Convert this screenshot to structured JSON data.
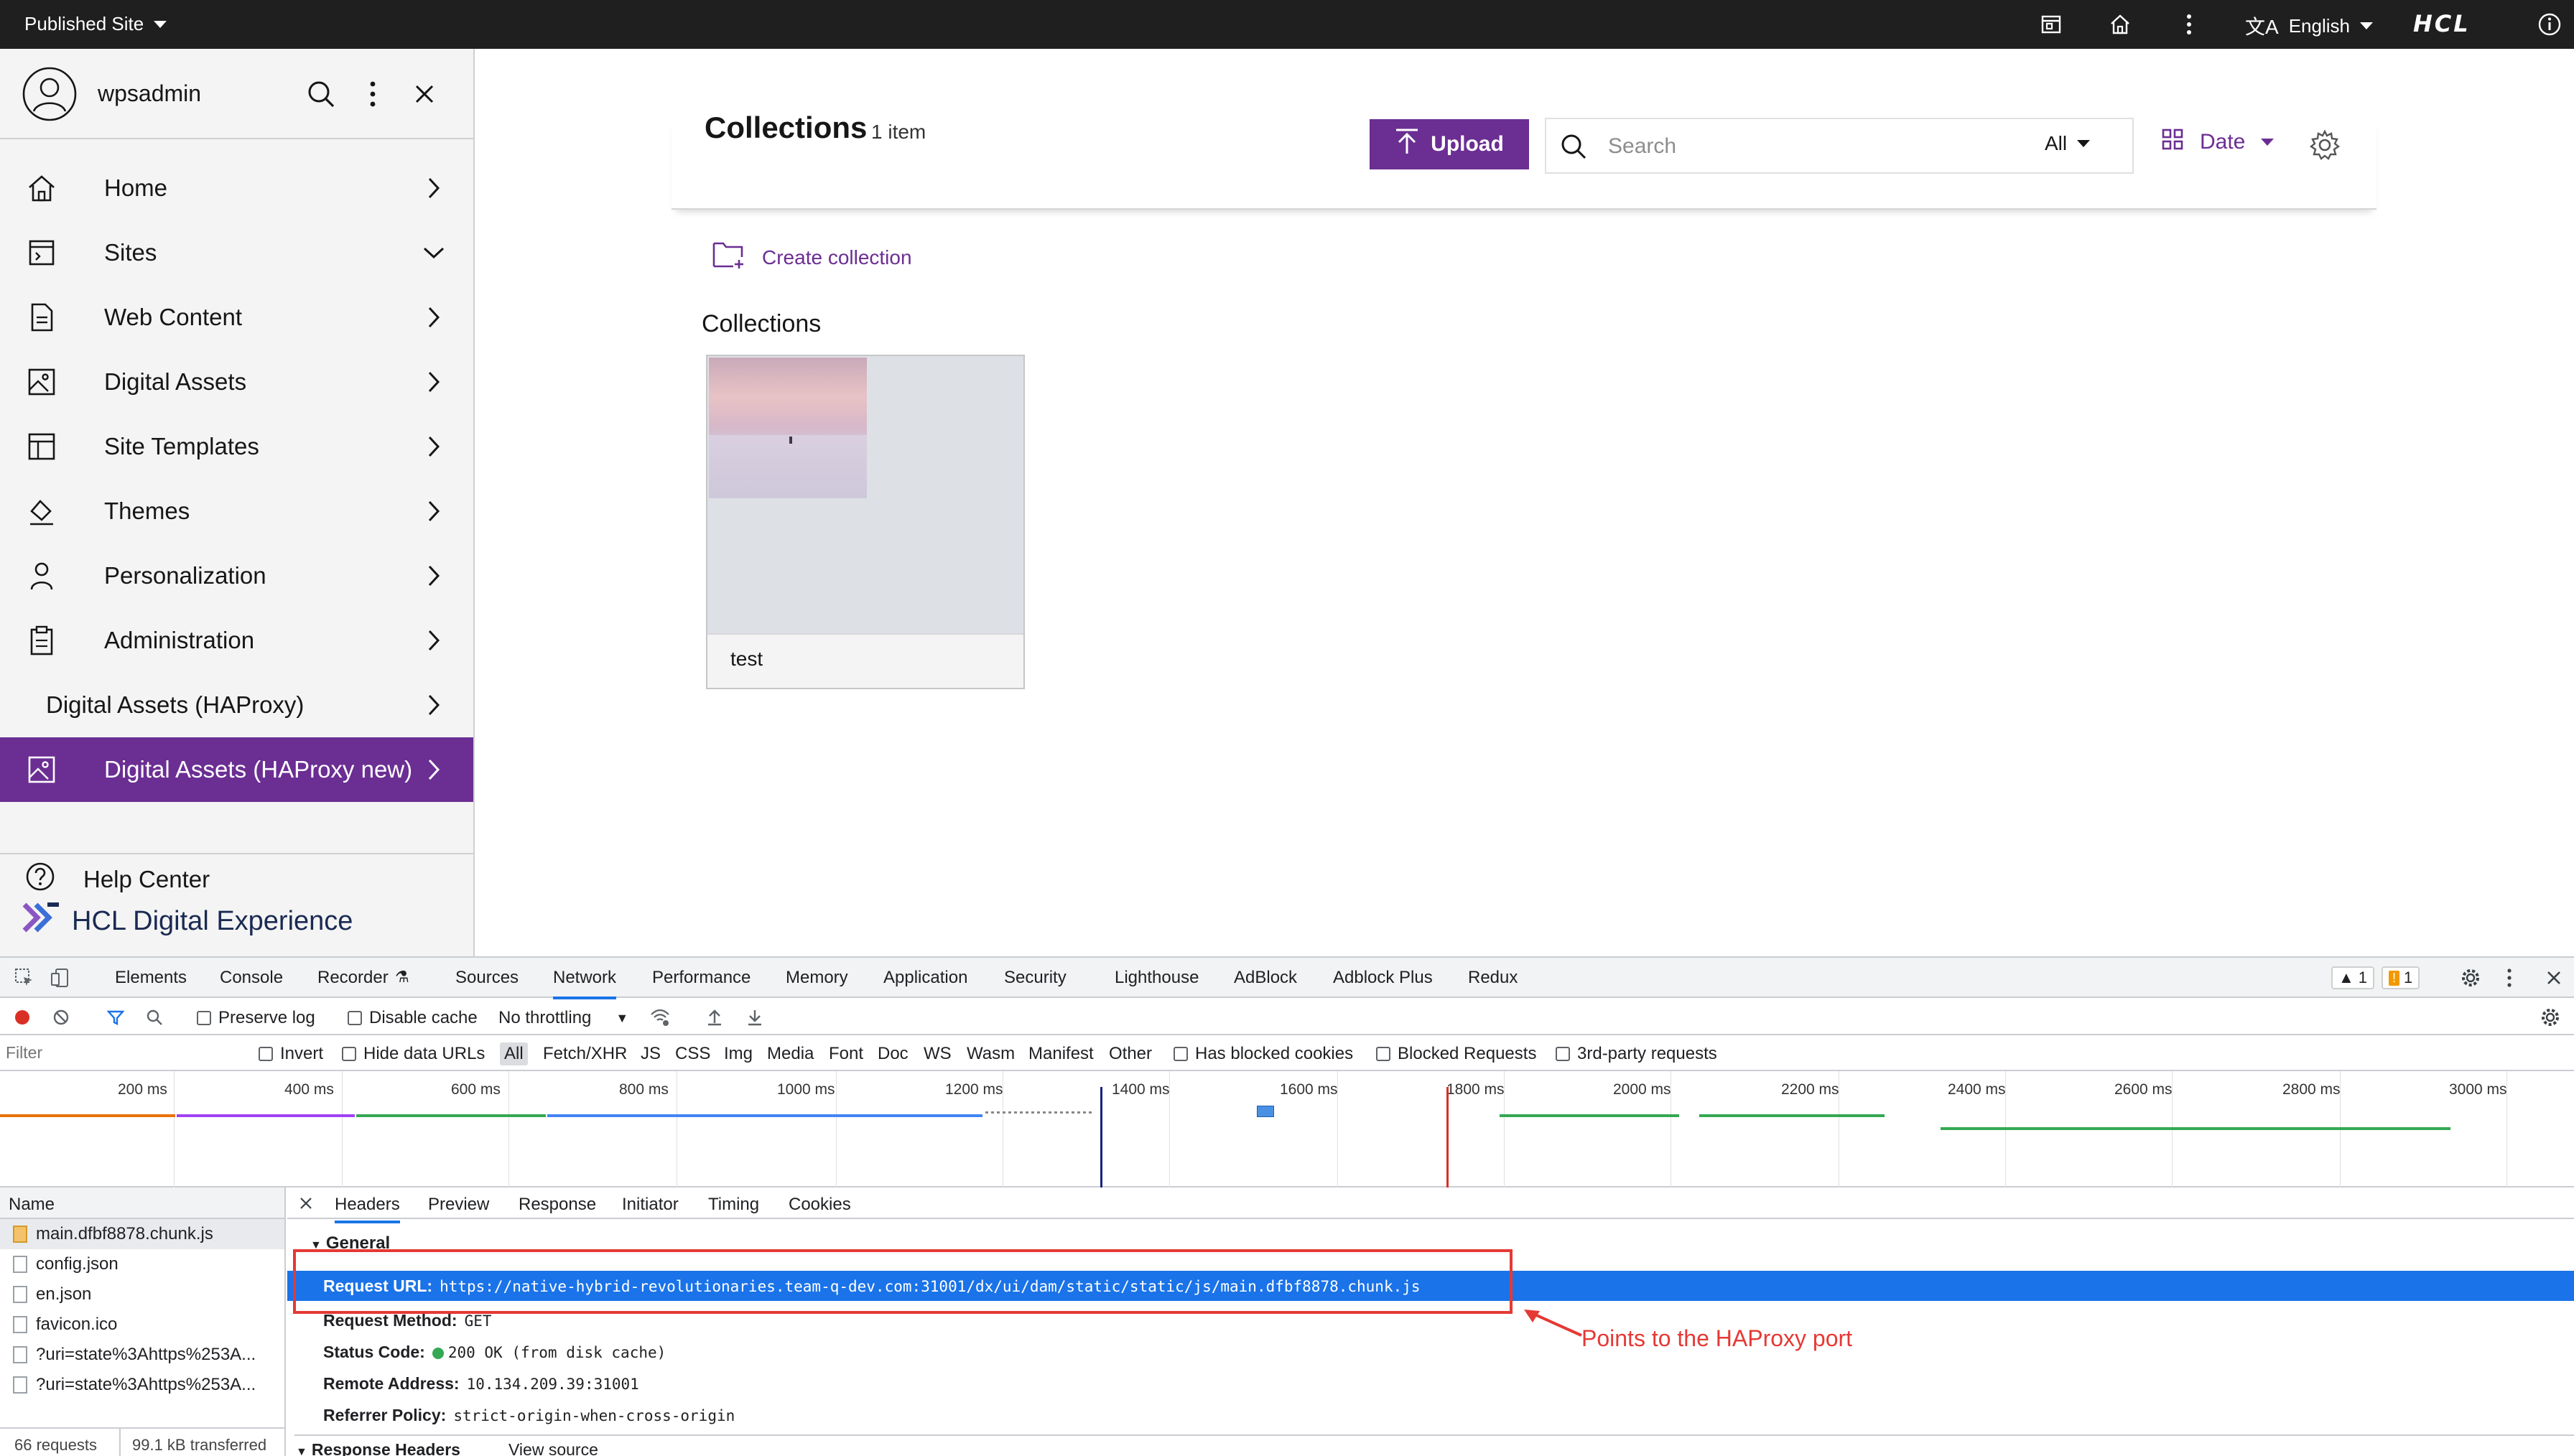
{
  "topbar": {
    "site_label": "Published Site",
    "language": "English",
    "logo": "HCL",
    "icons": [
      "page-icon",
      "home-icon",
      "kebab-icon",
      "translate-icon",
      "info-icon"
    ]
  },
  "sidebar": {
    "username": "wpsadmin",
    "items": [
      {
        "label": "Home",
        "icon": "home-icon",
        "chevron": "right"
      },
      {
        "label": "Sites",
        "icon": "sites-icon",
        "chevron": "down"
      },
      {
        "label": "Web Content",
        "icon": "document-icon",
        "chevron": "right"
      },
      {
        "label": "Digital Assets",
        "icon": "image-icon",
        "chevron": "right"
      },
      {
        "label": "Site Templates",
        "icon": "template-icon",
        "chevron": "right"
      },
      {
        "label": "Themes",
        "icon": "paint-bucket-icon",
        "chevron": "right"
      },
      {
        "label": "Personalization",
        "icon": "person-icon",
        "chevron": "right"
      },
      {
        "label": "Administration",
        "icon": "clipboard-icon",
        "chevron": "right"
      },
      {
        "label": "Digital Assets (HAProxy)",
        "icon": "",
        "chevron": "right"
      },
      {
        "label": "Digital Assets (HAProxy new)",
        "icon": "image-icon",
        "chevron": "right",
        "active": true
      }
    ],
    "help": "Help Center",
    "brand": "HCL Digital Experience",
    "accent": "#6b2e93"
  },
  "main": {
    "title": "Collections",
    "count": "1 item",
    "upload": "Upload",
    "search_placeholder": "Search",
    "filter": "All",
    "sort": "Date",
    "create": "Create collection",
    "section": "Collections",
    "card_name": "test"
  },
  "devtools": {
    "tabs": [
      "Elements",
      "Console",
      "Recorder",
      "Sources",
      "Network",
      "Performance",
      "Memory",
      "Application",
      "Security",
      "Lighthouse",
      "AdBlock",
      "Adblock Plus",
      "Redux"
    ],
    "selected_tab": "Network",
    "warn_count": "1",
    "issue_count": "1",
    "preserve_log": "Preserve log",
    "disable_cache": "Disable cache",
    "throttling": "No throttling",
    "filter_placeholder": "Filter",
    "invert": "Invert",
    "hide_data_urls": "Hide data URLs",
    "types": [
      "All",
      "Fetch/XHR",
      "JS",
      "CSS",
      "Img",
      "Media",
      "Font",
      "Doc",
      "WS",
      "Wasm",
      "Manifest",
      "Other"
    ],
    "blocked_cookies": "Has blocked cookies",
    "blocked_requests": "Blocked Requests",
    "third_party": "3rd-party requests",
    "ticks": [
      "200 ms",
      "400 ms",
      "600 ms",
      "800 ms",
      "1000 ms",
      "1200 ms",
      "1400 ms",
      "1600 ms",
      "1800 ms",
      "2000 ms",
      "2200 ms",
      "2400 ms",
      "2600 ms",
      "2800 ms",
      "3000 ms"
    ],
    "name_header": "Name",
    "files": [
      "main.dfbf8878.chunk.js",
      "config.json",
      "en.json",
      "favicon.ico",
      "?uri=state%3Ahttps%253A...",
      "?uri=state%3Ahttps%253A..."
    ],
    "requests": "66 requests",
    "transferred": "99.1 kB transferred",
    "detail_tabs": [
      "Headers",
      "Preview",
      "Response",
      "Initiator",
      "Timing",
      "Cookies"
    ],
    "general": "General",
    "request_url_k": "Request URL:",
    "request_url_v": "https://native-hybrid-revolutionaries.team-q-dev.com:31001/dx/ui/dam/static/static/js/main.dfbf8878.chunk.js",
    "method_k": "Request Method:",
    "method_v": "GET",
    "status_k": "Status Code:",
    "status_v": "200 OK (from disk cache)",
    "remote_k": "Remote Address:",
    "remote_v": "10.134.209.39:31001",
    "referrer_k": "Referrer Policy:",
    "referrer_v": "strict-origin-when-cross-origin",
    "response_headers": "Response Headers",
    "view_source": "View source"
  },
  "annotation": {
    "text": "Points to the HAProxy port",
    "color": "#e53935"
  }
}
